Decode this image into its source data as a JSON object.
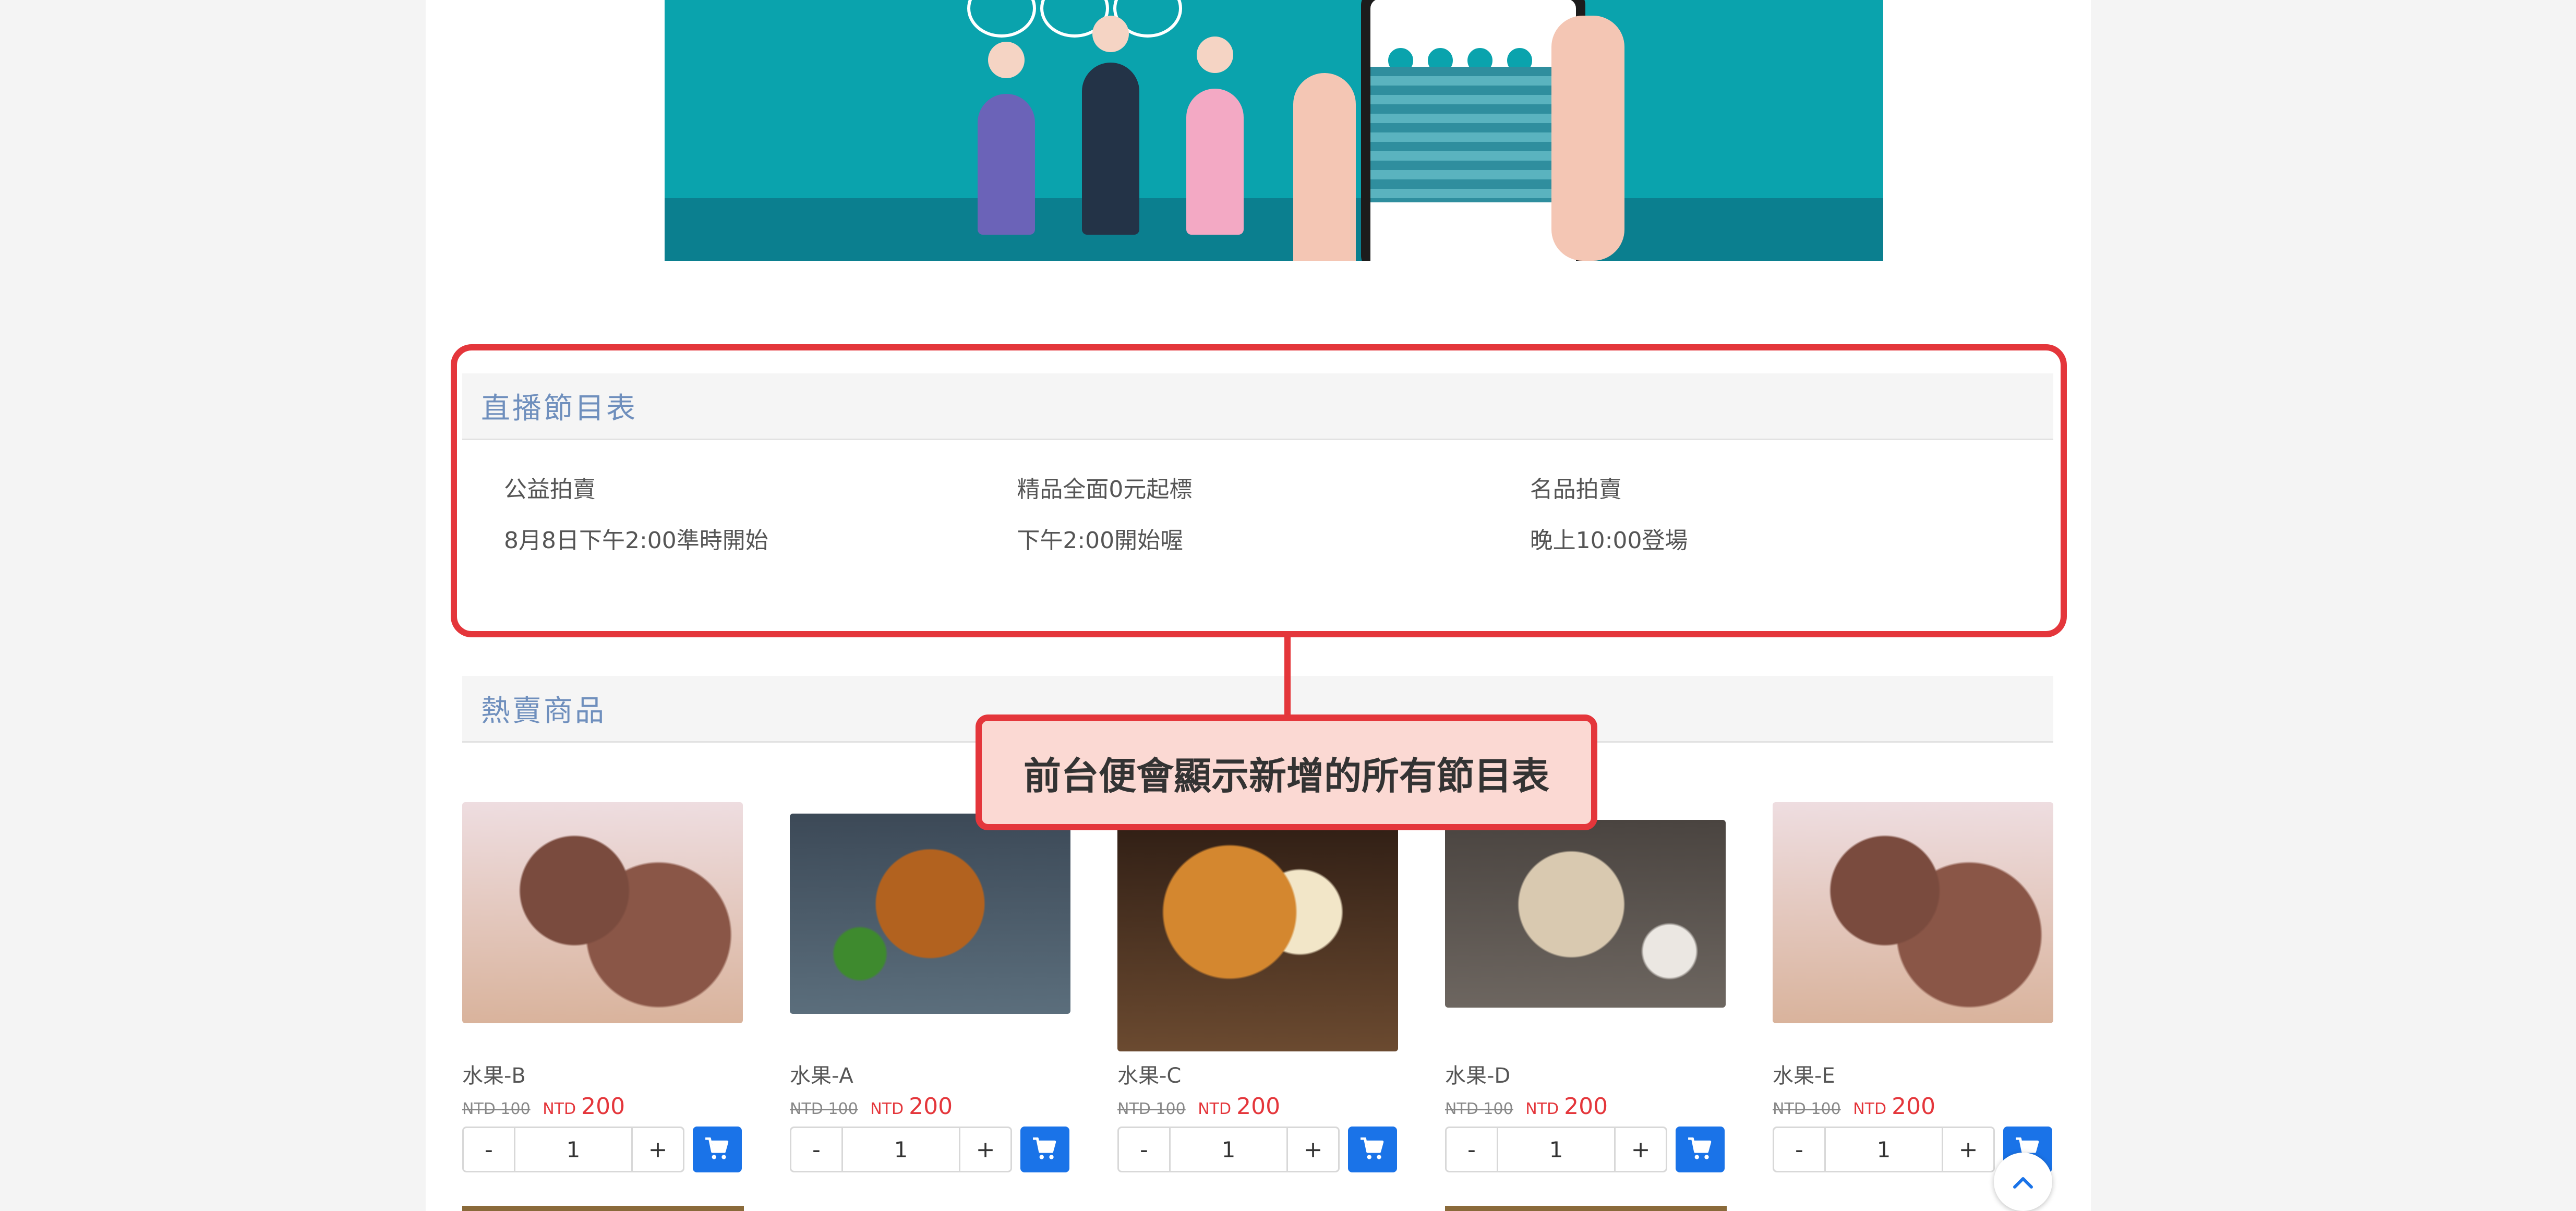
{
  "schedule": {
    "title": "直播節目表",
    "items": [
      {
        "name": "公益拍賣",
        "time": "8月8日下午2:00準時開始"
      },
      {
        "name": "精品全面0元起標",
        "time": "下午2:00開始喔"
      },
      {
        "name": "名品拍賣",
        "time": "晚上10:00登場"
      }
    ]
  },
  "hot": {
    "title": "熱賣商品"
  },
  "callout": "前台便會顯示新增的所有節目表",
  "products": [
    {
      "name": "水果-B",
      "old_price": "NTD 100",
      "currency": "NTD",
      "price": "200",
      "qty": "1"
    },
    {
      "name": "水果-A",
      "old_price": "NTD 100",
      "currency": "NTD",
      "price": "200",
      "qty": "1"
    },
    {
      "name": "水果-C",
      "old_price": "NTD 100",
      "currency": "NTD",
      "price": "200",
      "qty": "1"
    },
    {
      "name": "水果-D",
      "old_price": "NTD 100",
      "currency": "NTD",
      "price": "200",
      "qty": "1"
    },
    {
      "name": "水果-E",
      "old_price": "NTD 100",
      "currency": "NTD",
      "price": "200",
      "qty": "1"
    }
  ],
  "controls": {
    "minus": "-",
    "plus": "+"
  },
  "icons": {
    "cart": "cart-icon",
    "back_to_top": "chevron-up-icon"
  },
  "colors": {
    "accent": "#e4363b",
    "primary": "#1a73e8",
    "panel_title": "#6f8fbd"
  }
}
